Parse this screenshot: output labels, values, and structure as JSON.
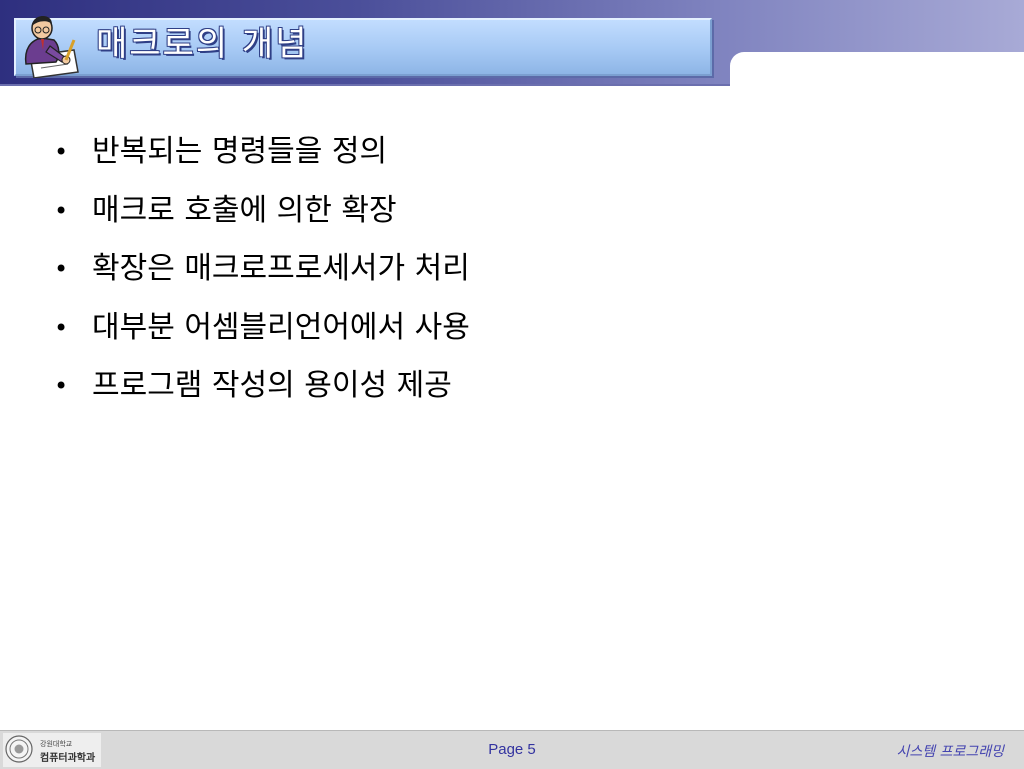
{
  "slide": {
    "title": "매크로의 개념",
    "bullets": [
      "반복되는 명령들을 정의",
      "매크로 호출에 의한 확장",
      "확장은 매크로프로세서가 처리",
      "대부분 어셈블리언어에서 사용",
      "프로그램 작성의 용이성 제공"
    ],
    "bullet_symbol": "•"
  },
  "footer": {
    "logo_line1": "강원대학교",
    "logo_line2": "컴퓨터과학과",
    "page": "Page 5",
    "course": "시스템 프로그래밍"
  },
  "icons": {
    "header": "person-writing-icon",
    "logo": "university-seal-icon"
  },
  "colors": {
    "header_dark": "#2e2f7f",
    "header_light": "#a8aad6",
    "title_panel": "#a6c9f4",
    "footer_text": "#3333a0"
  }
}
